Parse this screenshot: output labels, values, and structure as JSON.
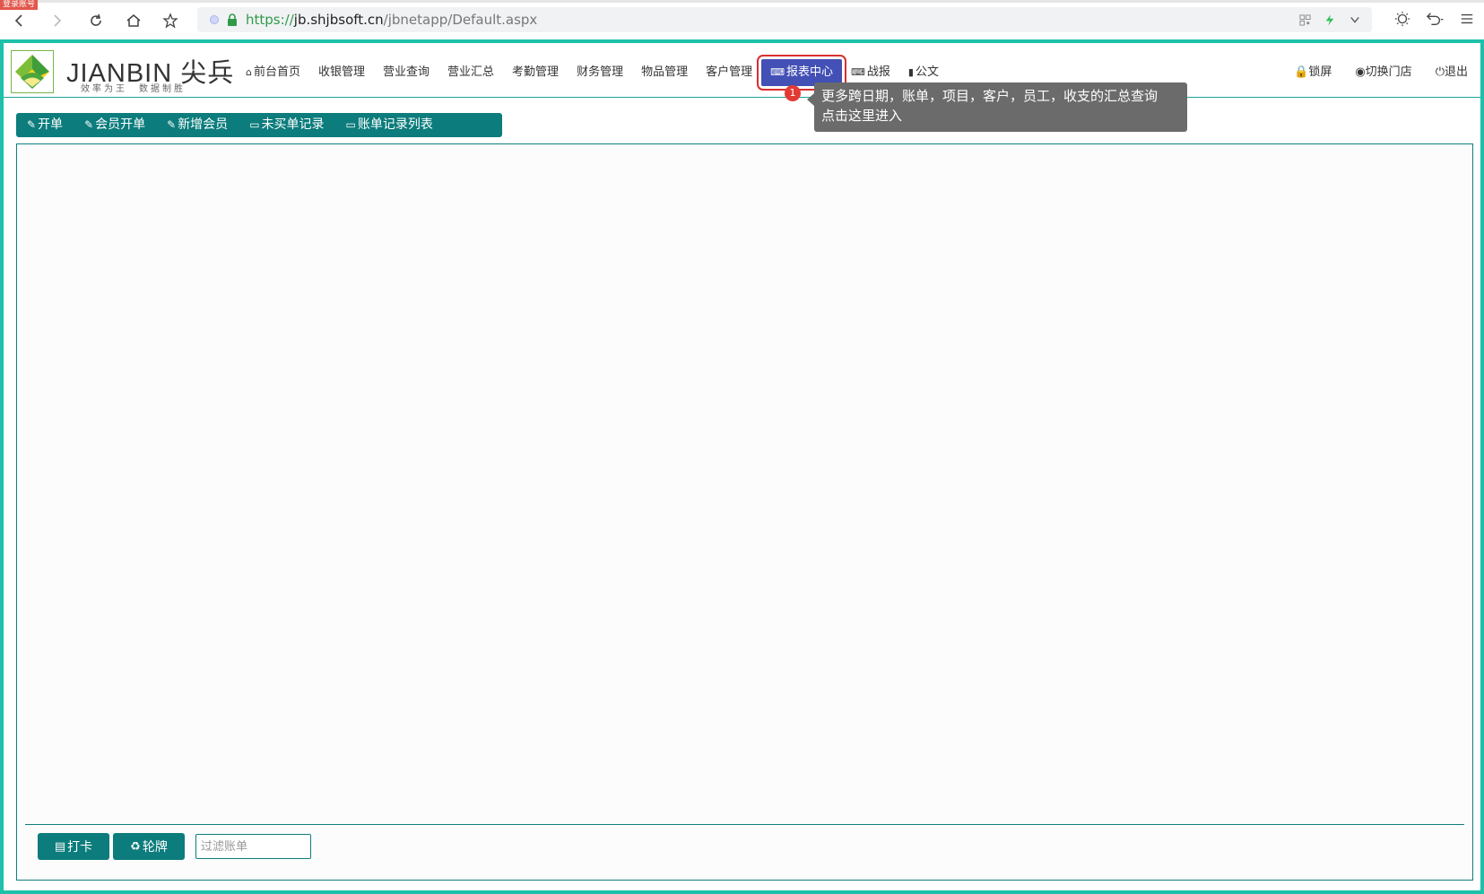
{
  "browser": {
    "login_tag": "登录账号",
    "url_scheme": "https://",
    "url_host": "jb.shjbsoft.cn",
    "url_path": "/jbnetapp/Default.aspx"
  },
  "logo": {
    "brand": "JIANBIN 尖兵",
    "slogan": "效率为王　数据制胜"
  },
  "main_nav": [
    {
      "icon": "home-icon",
      "label": "前台首页"
    },
    {
      "label": "收银管理"
    },
    {
      "label": "营业查询"
    },
    {
      "label": "营业汇总"
    },
    {
      "label": "考勤管理"
    },
    {
      "label": "财务管理"
    },
    {
      "label": "物品管理"
    },
    {
      "label": "客户管理"
    },
    {
      "icon": "keyboard-icon",
      "label": "报表中心",
      "active": true
    },
    {
      "icon": "keyboard-icon",
      "label": "战报"
    },
    {
      "icon": "book-icon",
      "label": "公文"
    }
  ],
  "right_nav": [
    {
      "icon": "lock-icon",
      "label": "锁屏"
    },
    {
      "icon": "pin-icon",
      "label": "切换门店"
    },
    {
      "icon": "power-icon",
      "label": "退出"
    }
  ],
  "tooltip": {
    "badge": "1",
    "line1": "更多跨日期，账单，项目，客户，员工，收支的汇总查询",
    "line2": "点击这里进入"
  },
  "toolbar": [
    {
      "icon": "edit-icon",
      "label": "开单"
    },
    {
      "icon": "edit-icon",
      "label": "会员开单"
    },
    {
      "icon": "edit-icon",
      "label": "新增会员"
    },
    {
      "icon": "monitor-icon",
      "label": "未买单记录"
    },
    {
      "icon": "monitor-icon",
      "label": "账单记录列表"
    }
  ],
  "footer": {
    "punch_label": "打卡",
    "rotation_label": "轮牌",
    "filter_placeholder": "过滤账单"
  },
  "colors": {
    "frame": "#1ec0aa",
    "primary": "#0c7c7c",
    "active_nav": "#4350b5",
    "highlight_border": "#d9302e",
    "tooltip_bg": "#6b6b6b"
  }
}
